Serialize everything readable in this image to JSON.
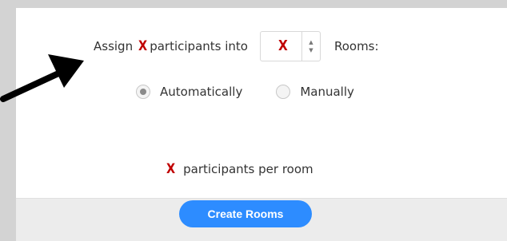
{
  "assign": {
    "prefix": "Assign",
    "marker": "X",
    "middle": "participants into",
    "count_value": "X",
    "suffix": "Rooms:"
  },
  "options": {
    "automatic_label": "Automatically",
    "manual_label": "Manually",
    "selected": "Automatically"
  },
  "per_room": {
    "marker": "X",
    "label": "participants per room"
  },
  "footer": {
    "create_label": "Create Rooms"
  },
  "colors": {
    "accent": "#2d8cff",
    "marker": "#c00000",
    "background": "#d3d3d3",
    "arrow": "#000000"
  },
  "icons": {
    "spinner_up": "caret-up-icon",
    "spinner_down": "caret-down-icon",
    "pointer": "arrow-icon"
  }
}
